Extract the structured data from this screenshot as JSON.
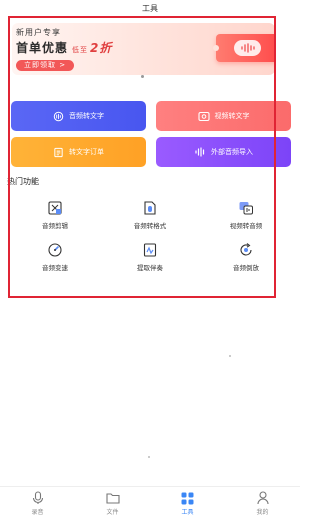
{
  "header": {
    "title": "工具"
  },
  "banner": {
    "line1": "新用户专享",
    "line2": "首单优惠",
    "low_label": "低至",
    "discount": "2折",
    "cta": "立即领取 >"
  },
  "actions": [
    {
      "label": "音频转文字",
      "icon": "speech-to-text-icon",
      "color": "#4f5cf2"
    },
    {
      "label": "视频转文字",
      "icon": "video-to-text-icon",
      "color": "#fb6f6f"
    },
    {
      "label": "转文字订单",
      "icon": "order-icon",
      "color": "#ffab2e"
    },
    {
      "label": "外部音频导入",
      "icon": "audio-import-icon",
      "color": "#8a4ffb"
    }
  ],
  "section": {
    "title": "热门功能"
  },
  "features": [
    {
      "label": "音频剪辑",
      "icon": "audio-cut-icon"
    },
    {
      "label": "音频转格式",
      "icon": "audio-format-icon"
    },
    {
      "label": "视频转音频",
      "icon": "video-to-audio-icon"
    },
    {
      "label": "音频变速",
      "icon": "audio-speed-icon"
    },
    {
      "label": "提取伴奏",
      "icon": "extract-accompaniment-icon"
    },
    {
      "label": "音频倒放",
      "icon": "audio-reverse-icon"
    }
  ],
  "tabs": [
    {
      "label": "录音",
      "icon": "mic-icon",
      "active": false
    },
    {
      "label": "文件",
      "icon": "folder-icon",
      "active": false
    },
    {
      "label": "工具",
      "icon": "grid-icon",
      "active": true
    },
    {
      "label": "我的",
      "icon": "user-icon",
      "active": false
    }
  ],
  "colors": {
    "accent": "#3a86f5",
    "highlight": "#e02434"
  }
}
